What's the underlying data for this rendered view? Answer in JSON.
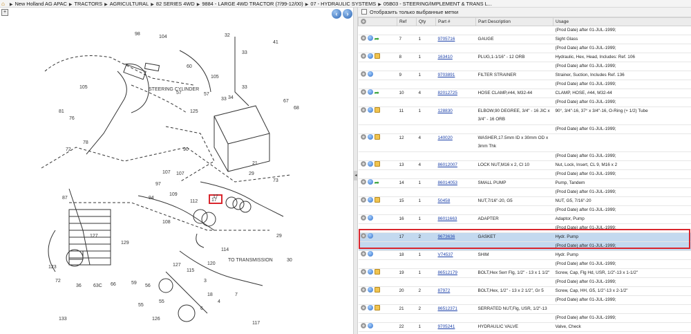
{
  "breadcrumb": [
    "New Holland AG APAC",
    "TRACTORS",
    "AGRICULTURAL",
    "82 SERIES 4WD",
    "9884 - LARGE 4WD TRACTOR (7/99-12/00)",
    "07 - HYDRAULIC SYSTEMS",
    "05B03 - STEERING/IMPLEMENT & TRANS L..."
  ],
  "filter_label": "Отобразить только выбранные метки",
  "columns": [
    "Ref",
    "Qty",
    "Part #",
    "Part Description",
    "Usage"
  ],
  "diagram_labels": {
    "steering": "STEERING CYLINDER",
    "transmission": "TO TRANSMISSION",
    "highlight": "17",
    "callouts": [
      "98",
      "104",
      "32",
      "41",
      "105",
      "33",
      "60",
      "57",
      "125",
      "33",
      "57",
      "105",
      "34",
      "33",
      "67",
      "68",
      "81",
      "76",
      "78",
      "72",
      "90",
      "21",
      "29",
      "73",
      "94",
      "97",
      "107",
      "107",
      "109",
      "108",
      "112",
      "87",
      "127",
      "129",
      "115",
      "3",
      "7",
      "55",
      "133",
      "117",
      "72",
      "123",
      "127",
      "36",
      "63C",
      "66",
      "59",
      "56",
      "55",
      "126",
      "17",
      "114",
      "29",
      "30",
      "120",
      "4",
      "6",
      "18"
    ]
  },
  "rows": [
    {
      "ref": "",
      "qty": "",
      "part": "",
      "desc": "",
      "usage": "(Prod Date) after 01-JUL-1999;",
      "icons": "none"
    },
    {
      "ref": "7",
      "qty": "1",
      "part": "9705716",
      "desc": "GAUGE",
      "usage": "Sight Glass",
      "icons": "green"
    },
    {
      "ref": "",
      "qty": "",
      "part": "",
      "desc": "",
      "usage": "(Prod Date) after 01-JUL-1999;",
      "icons": "none"
    },
    {
      "ref": "8",
      "qty": "1",
      "part": "163410",
      "desc": "PLUG,1-1/16\" - 12 ORB",
      "usage": "Hydraulic, Hex, Head, Includes: Ref. 106",
      "icons": "pkg"
    },
    {
      "ref": "",
      "qty": "",
      "part": "",
      "desc": "",
      "usage": "(Prod Date) after 01-JUL-1999;",
      "icons": "none"
    },
    {
      "ref": "9",
      "qty": "1",
      "part": "9703891",
      "desc": "FILTER STRAINER",
      "usage": "Strainer, Suction, Includes Ref. 136",
      "icons": "plain"
    },
    {
      "ref": "",
      "qty": "",
      "part": "",
      "desc": "",
      "usage": "(Prod Date) after 01-JUL-1999;",
      "icons": "none"
    },
    {
      "ref": "10",
      "qty": "4",
      "part": "82012725",
      "desc": "HOSE CLAMP,#44, M32-44",
      "usage": "CLAMP, HOSE, #44, M32-44",
      "icons": "green"
    },
    {
      "ref": "",
      "qty": "",
      "part": "",
      "desc": "",
      "usage": "(Prod Date) after 01-JUL-1999;",
      "icons": "none"
    },
    {
      "ref": "11",
      "qty": "1",
      "part": "128830",
      "desc": "ELBOW,90 DEGREE, 3/4\" - 16 JIC x 3/4\" - 16 ORB",
      "usage": "90°, 3/4\"-16, 37° x 3/4\"-16, O-Ring (+ 1/2) Tube",
      "icons": "pkg",
      "tall": true
    },
    {
      "ref": "",
      "qty": "",
      "part": "",
      "desc": "",
      "usage": "(Prod Date) after 01-JUL-1999;",
      "icons": "none"
    },
    {
      "ref": "12",
      "qty": "4",
      "part": "140020",
      "desc": "WASHER,17.5mm ID x 30mm OD x 3mm Thk",
      "usage": "",
      "icons": "pkg",
      "tall": true
    },
    {
      "ref": "",
      "qty": "",
      "part": "",
      "desc": "",
      "usage": "(Prod Date) after 01-JUL-1999;",
      "icons": "none"
    },
    {
      "ref": "13",
      "qty": "4",
      "part": "86012007",
      "desc": "LOCK NUT,M16 x 2, Cl 10",
      "usage": "Nut, Lock, Insert, CL 9, M16 x 2",
      "icons": "pkg"
    },
    {
      "ref": "",
      "qty": "",
      "part": "",
      "desc": "",
      "usage": "(Prod Date) after 01-JUL-1999;",
      "icons": "none"
    },
    {
      "ref": "14",
      "qty": "1",
      "part": "86014053",
      "desc": "SMALL PUMP",
      "usage": "Pump, Tandem",
      "icons": "green"
    },
    {
      "ref": "",
      "qty": "",
      "part": "",
      "desc": "",
      "usage": "(Prod Date) after 01-JUL-1999;",
      "icons": "none"
    },
    {
      "ref": "15",
      "qty": "1",
      "part": "50458",
      "desc": "NUT,7/16\"-20, G5",
      "usage": "NUT, G5, 7/16\"-20",
      "icons": "pkg"
    },
    {
      "ref": "",
      "qty": "",
      "part": "",
      "desc": "",
      "usage": "(Prod Date) after 01-JUL-1999;",
      "icons": "none"
    },
    {
      "ref": "16",
      "qty": "1",
      "part": "86011663",
      "desc": "ADAPTER",
      "usage": "Adaptor, Pump",
      "icons": "plain"
    },
    {
      "ref": "",
      "qty": "",
      "part": "",
      "desc": "",
      "usage": "(Prod Date) after 01-JUL-1999;",
      "icons": "none"
    },
    {
      "ref": "17",
      "qty": "2",
      "part": "9673636",
      "desc": "GASKET",
      "usage": "Hydr. Pump",
      "icons": "plain",
      "sel": true
    },
    {
      "ref": "",
      "qty": "",
      "part": "",
      "desc": "",
      "usage": "(Prod Date) after 01-JUL-1999;",
      "icons": "none",
      "sel": true
    },
    {
      "ref": "18",
      "qty": "1",
      "part": "V74537",
      "desc": "SHIM",
      "usage": "Hydr. Pump",
      "icons": "plain"
    },
    {
      "ref": "",
      "qty": "",
      "part": "",
      "desc": "",
      "usage": "(Prod Date) after 01-JUL-1999;",
      "icons": "none"
    },
    {
      "ref": "19",
      "qty": "1",
      "part": "86512179",
      "desc": "BOLT,Hex Serr Flg, 1/2\" - 13 x 1 1/2\"",
      "usage": "Screw, Cap, Flg Hd, USR, 1/2\"-13 x 1-1/2\"",
      "icons": "pkg"
    },
    {
      "ref": "",
      "qty": "",
      "part": "",
      "desc": "",
      "usage": "(Prod Date) after 01-JUL-1999;",
      "icons": "none"
    },
    {
      "ref": "20",
      "qty": "2",
      "part": "87972",
      "desc": "BOLT,Hex, 1/2\" - 13 x 2 1/2\", Gr 5",
      "usage": "Screw, Cap, HH, G5, 1/2\"-13 x 2-1/2\"",
      "icons": "pkg"
    },
    {
      "ref": "",
      "qty": "",
      "part": "",
      "desc": "",
      "usage": "(Prod Date) after 01-JUL-1999;",
      "icons": "none"
    },
    {
      "ref": "21",
      "qty": "2",
      "part": "86512371",
      "desc": "SERRATED NUT,Flg, USR, 1/2\"-13",
      "usage": "",
      "icons": "pkg"
    },
    {
      "ref": "",
      "qty": "",
      "part": "",
      "desc": "",
      "usage": "(Prod Date) after 01-JUL-1999;",
      "icons": "none"
    },
    {
      "ref": "22",
      "qty": "1",
      "part": "9705241",
      "desc": "HYDRAULIC VALVE",
      "usage": "Valve, Check",
      "icons": "plain"
    }
  ]
}
